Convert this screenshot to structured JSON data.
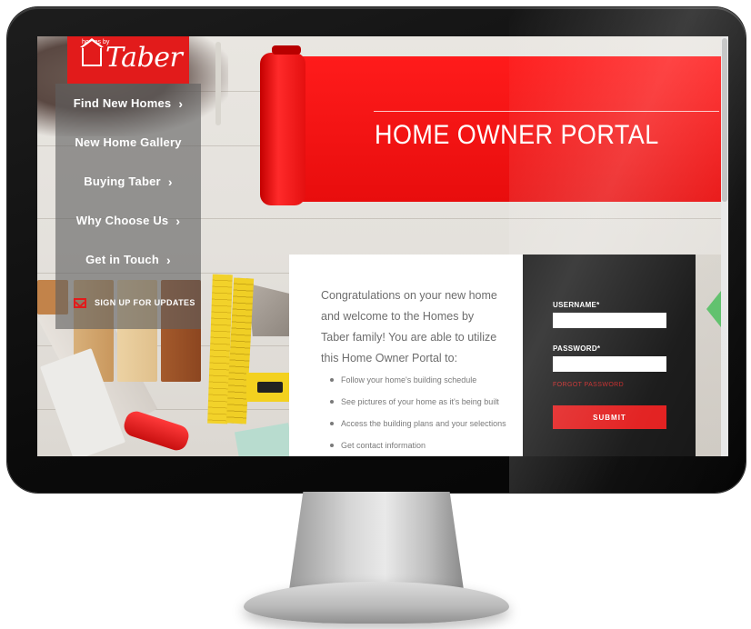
{
  "logo": {
    "tagline": "homes by",
    "wordmark": "Taber"
  },
  "nav": {
    "items": [
      {
        "label": "Find New Homes",
        "chevron": "›"
      },
      {
        "label": "New Home Gallery",
        "chevron": ""
      },
      {
        "label": "Buying Taber",
        "chevron": "›"
      },
      {
        "label": "Why Choose Us",
        "chevron": "›"
      },
      {
        "label": "Get in Touch",
        "chevron": "›"
      }
    ],
    "updates_label": "SIGN UP FOR UPDATES",
    "updates_icon": "mail-icon"
  },
  "hero": {
    "title": "HOME OWNER PORTAL"
  },
  "content": {
    "intro": "Congratulations on your new home and welcome to the Homes by Taber family! You are able to utilize this Home Owner Portal to:",
    "bullets": [
      "Follow your home's building schedule",
      "See pictures of your home as it's being built",
      "Access the building plans and your selections",
      "Get contact information"
    ]
  },
  "login": {
    "username_label": "USERNAME*",
    "username_value": "",
    "password_label": "PASSWORD*",
    "password_value": "",
    "forgot_label": "FORGOT PASSWORD",
    "submit_label": "SUBMIT"
  },
  "colors": {
    "brand_red": "#e21b1b",
    "login_bg": "#141414",
    "nav_bg": "rgba(95,95,95,0.62)"
  }
}
